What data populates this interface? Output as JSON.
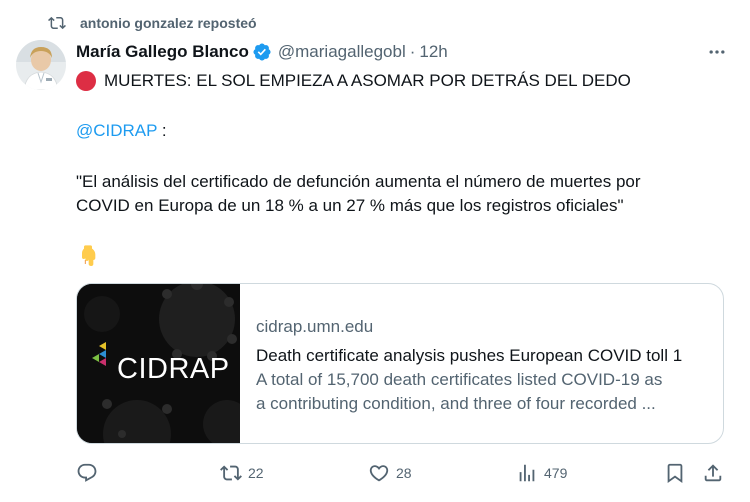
{
  "repost": {
    "text": "antonio gonzalez reposteó",
    "icon": "repost-icon"
  },
  "author": {
    "name": "María Gallego Blanco",
    "handle": "@mariagallegobl",
    "separator": "·",
    "time": "12h",
    "verified_icon": "verified-badge-icon",
    "avatar_icon": "avatar-photo"
  },
  "tweet": {
    "line1": "MUERTES: EL SOL EMPIEZA A ASOMAR POR DETRÁS DEL DEDO",
    "mention": "@CIDRAP",
    "mention_suffix": " :",
    "quote_line1": "\"El análisis del certificado de defunción aumenta el número de muertes por",
    "quote_line2": "COVID en Europa de un 18 % a un 27 % más que los registros oficiales\"",
    "emoji_icon": "pointing-down-icon"
  },
  "card": {
    "logo_text": "CIDRAP",
    "domain": "cidrap.umn.edu",
    "title": "Death certificate analysis pushes European COVID toll 1",
    "desc_line1": "A total of 15,700 death certificates listed COVID-19 as",
    "desc_line2": "a contributing condition, and three of four recorded ..."
  },
  "actions": {
    "reply_count": "",
    "repost_count": "22",
    "like_count": "28",
    "views_count": "479"
  },
  "colors": {
    "accent": "#1d9bf0",
    "muted": "#536471",
    "text": "#0f1419",
    "border": "#cfd9de",
    "red_circle": "#dd2e44"
  }
}
